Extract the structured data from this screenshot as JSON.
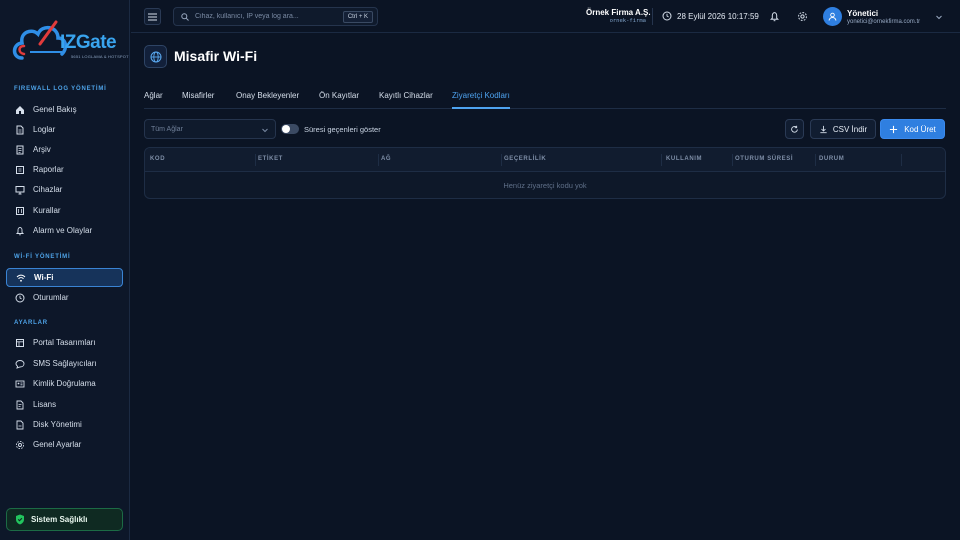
{
  "brand": {
    "logo_text": "IZGate",
    "logo_subtitle": "5651 LOGLAMA & HOTSPOT"
  },
  "sidebar": {
    "sections": [
      {
        "title": "FIREWALL LOG YÖNETİMİ",
        "items": [
          {
            "label": "Genel Bakış",
            "icon": "home-icon"
          },
          {
            "label": "Loglar",
            "icon": "file-icon"
          },
          {
            "label": "Arşiv",
            "icon": "archive-icon"
          },
          {
            "label": "Raporlar",
            "icon": "report-icon"
          },
          {
            "label": "Cihazlar",
            "icon": "monitor-icon"
          },
          {
            "label": "Kurallar",
            "icon": "rules-icon"
          },
          {
            "label": "Alarm ve Olaylar",
            "icon": "bell-icon"
          }
        ]
      },
      {
        "title": "Wİ-Fİ YÖNETİMİ",
        "items": [
          {
            "label": "Wi-Fi",
            "icon": "wifi-icon",
            "active": true
          },
          {
            "label": "Oturumlar",
            "icon": "clock-icon"
          }
        ]
      },
      {
        "title": "AYARLAR",
        "items": [
          {
            "label": "Portal Tasarımları",
            "icon": "layout-icon"
          },
          {
            "label": "SMS Sağlayıcıları",
            "icon": "message-icon"
          },
          {
            "label": "Kimlik Doğrulama",
            "icon": "id-card-icon"
          },
          {
            "label": "Lisans",
            "icon": "license-icon"
          },
          {
            "label": "Disk Yönetimi",
            "icon": "disk-icon"
          },
          {
            "label": "Genel Ayarlar",
            "icon": "gear-icon"
          }
        ]
      }
    ],
    "health_label": "Sistem Sağlıklı"
  },
  "topbar": {
    "search_placeholder": "Cihaz, kullanıcı, IP veya log ara...",
    "search_shortcut": "Ctrl + K",
    "company_name": "Örnek Firma A.Ş.",
    "company_code": "ornek-firma",
    "datetime": "28 Eylül 2026 10:17:59",
    "user_name": "Yönetici",
    "user_email": "yonetici@ornekfirma.com.tr"
  },
  "page": {
    "title": "Misafir Wi-Fi",
    "tabs": [
      "Ağlar",
      "Misafirler",
      "Onay Bekleyenler",
      "Ön Kayıtlar",
      "Kayıtlı Cihazlar",
      "Ziyaretçi Kodları"
    ],
    "active_tab": "Ziyaretçi Kodları"
  },
  "toolbar": {
    "network_filter": "Tüm Ağlar",
    "show_expired_label": "Süresi geçenleri göster",
    "show_expired": false,
    "csv_label": "CSV İndir",
    "add_label": "Kod Üret"
  },
  "table": {
    "columns": [
      "KOD",
      "ETİKET",
      "AĞ",
      "GEÇERLİLİK",
      "KULLANIM",
      "OTURUM SÜRESİ",
      "DURUM"
    ],
    "rows": [],
    "empty_text": "Henüz ziyaretçi kodu yok"
  },
  "colors": {
    "accent": "#2f7fe0",
    "tab_active": "#4ea3f0",
    "health_green": "#22c55e",
    "background": "#0b1424"
  }
}
